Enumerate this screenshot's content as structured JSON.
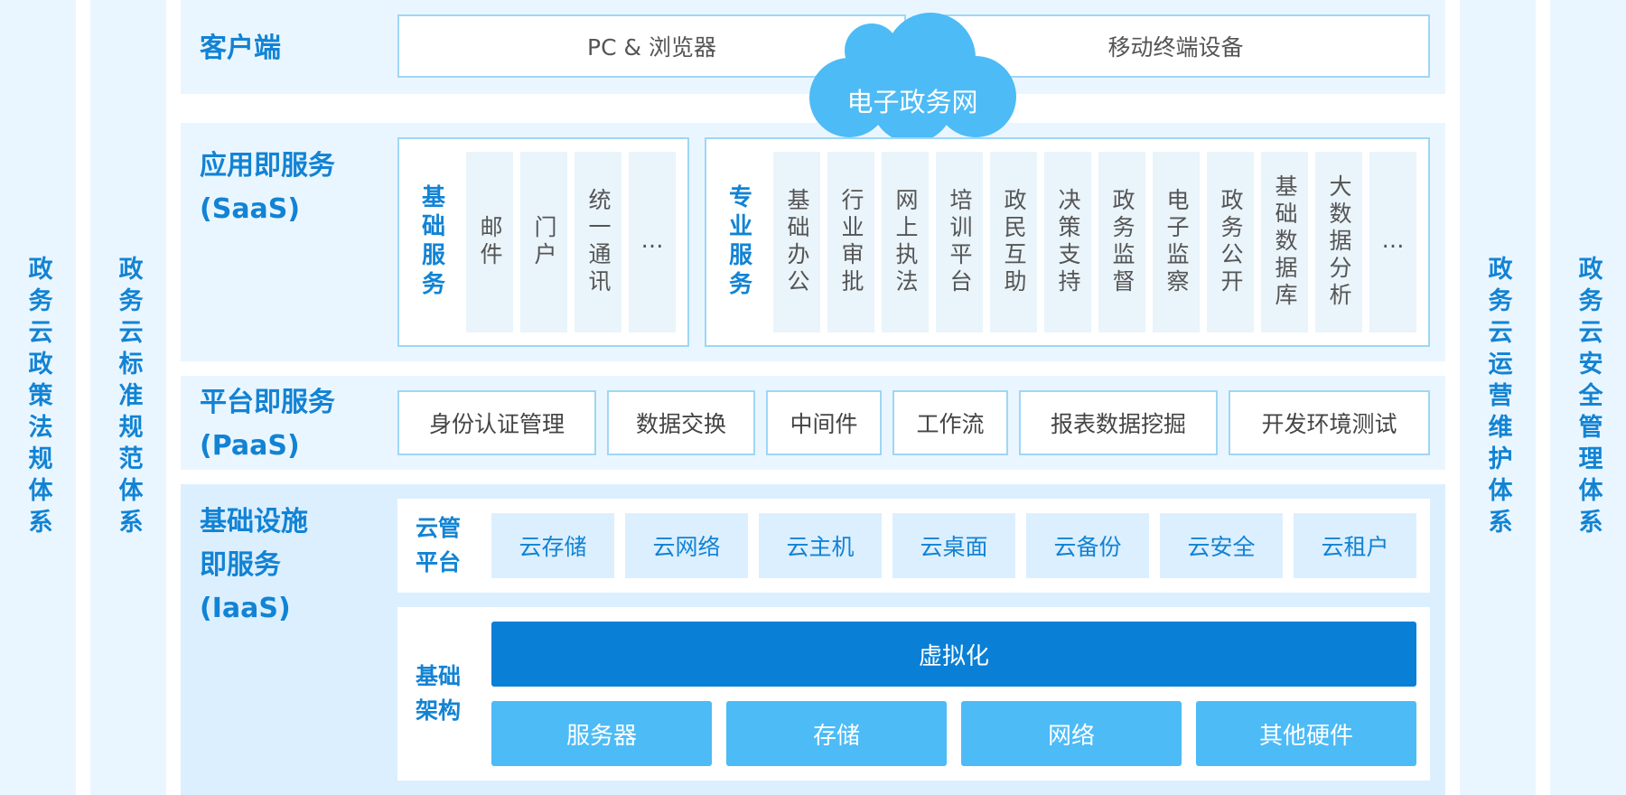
{
  "side_left": [
    "政务云政策法规体系",
    "政务云标准规范体系"
  ],
  "side_right": [
    "政务云运营维护体系",
    "政务云安全管理体系"
  ],
  "colors": {
    "accent": "#1283d4",
    "section_bg": "#eaf6ff",
    "iaas_bg": "#dcefff",
    "border": "#9fd6f5",
    "virtualization": "#0a7fd6",
    "hardware": "#4dbbf6",
    "cloud": "#4dbbf6"
  },
  "client": {
    "label": "客户端",
    "items": [
      "PC & 浏览器",
      "移动终端设备"
    ]
  },
  "cloud": {
    "label": "电子政务网",
    "icon": "cloud-icon"
  },
  "saas": {
    "label_line1": "应用即服务",
    "label_line2": "(SaaS)",
    "basic": {
      "label": "基础服务",
      "items": [
        "邮件",
        "门户",
        "统一通讯",
        "…"
      ]
    },
    "professional": {
      "label": "专业服务",
      "items": [
        "基础办公",
        "行业审批",
        "网上执法",
        "培训平台",
        "政民互助",
        "决策支持",
        "政务监督",
        "电子监察",
        "政务公开",
        "基础数据库",
        "大数据分析",
        "…"
      ]
    }
  },
  "paas": {
    "label_line1": "平台即服务",
    "label_line2": "(PaaS)",
    "items": [
      "身份认证管理",
      "数据交换",
      "中间件",
      "工作流",
      "报表数据挖掘",
      "开发环境测试"
    ]
  },
  "iaas": {
    "label_line1": "基础设施",
    "label_line2": "即服务",
    "label_line3": "(IaaS)",
    "cloud_mgmt": {
      "label_line1": "云管",
      "label_line2": "平台",
      "items": [
        "云存储",
        "云网络",
        "云主机",
        "云桌面",
        "云备份",
        "云安全",
        "云租户"
      ]
    },
    "infrastructure": {
      "label_line1": "基础",
      "label_line2": "架构",
      "virtualization": "虚拟化",
      "hardware": [
        "服务器",
        "存储",
        "网络",
        "其他硬件"
      ]
    }
  }
}
